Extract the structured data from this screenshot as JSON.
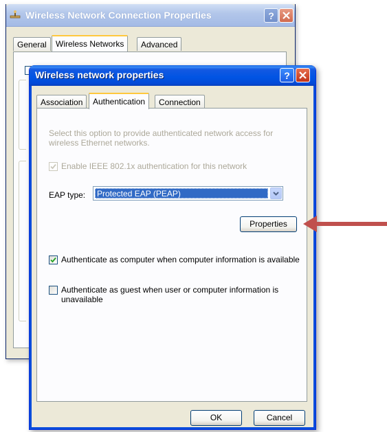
{
  "back_window": {
    "title": "Wireless Network Connection Properties",
    "tabs": [
      "General",
      "Wireless Networks",
      "Advanced"
    ],
    "active_tab": "Wireless Networks"
  },
  "dialog": {
    "title": "Wireless network properties",
    "tabs": [
      "Association",
      "Authentication",
      "Connection"
    ],
    "active_tab": "Authentication",
    "description": "Select this option to provide authenticated network access for wireless Ethernet networks.",
    "enable_8021x": {
      "label": "Enable IEEE 802.1x authentication for this network",
      "checked": true,
      "disabled": true
    },
    "eap_type": {
      "label": "EAP type:",
      "value": "Protected EAP (PEAP)"
    },
    "properties_button": "Properties",
    "auth_computer": {
      "label": "Authenticate as computer when computer information is available",
      "checked": true
    },
    "auth_guest": {
      "label": "Authenticate as guest when user or computer information is unavailable",
      "checked": false
    },
    "ok_button": "OK",
    "cancel_button": "Cancel"
  },
  "annotation": {
    "color": "#c0504d"
  }
}
